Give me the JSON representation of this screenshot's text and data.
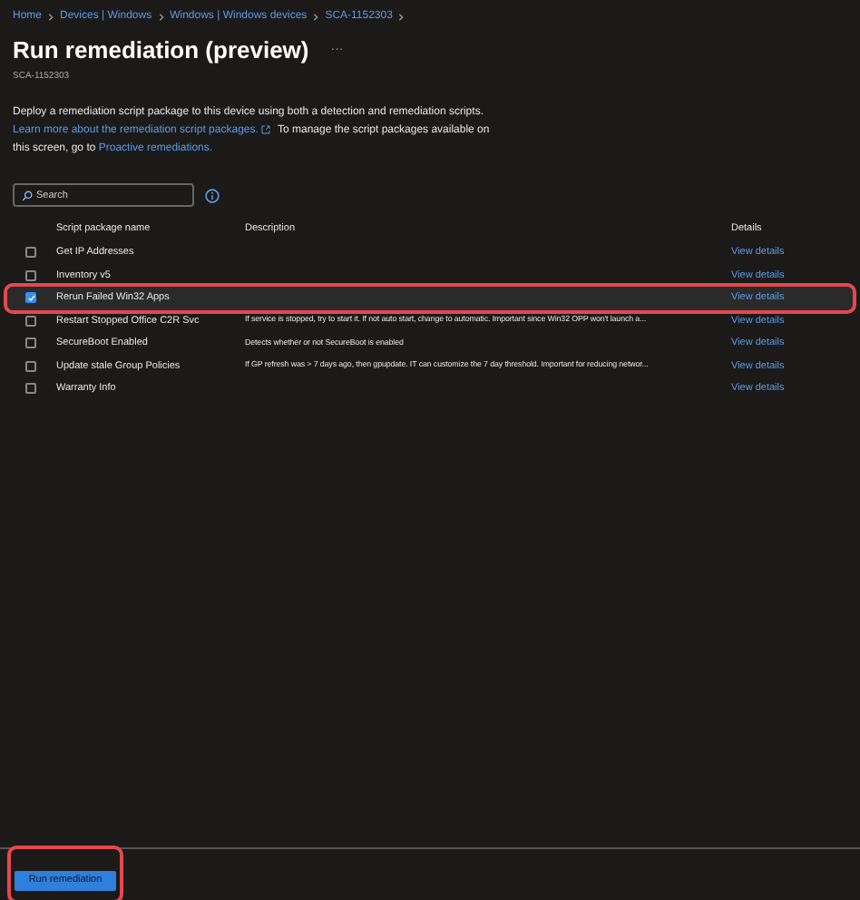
{
  "breadcrumb": [
    "Home",
    "Devices | Windows",
    "Windows | Windows devices",
    "SCA-1152303"
  ],
  "title": "Run remediation (preview)",
  "more": "···",
  "subtitle": "SCA-1152303",
  "intro": {
    "text": "Deploy a remediation script package to this device using both a detection and remediation scripts.",
    "link1": "Learn more about the remediation script packages.",
    "middle": "To manage the script packages available on this screen, go to",
    "link2": "Proactive remediations."
  },
  "search": {
    "placeholder": "Search"
  },
  "table": {
    "columns": [
      "Script package name",
      "Description",
      "Details"
    ],
    "rows": [
      {
        "name": "Get IP Addresses",
        "description": "",
        "details": "View details",
        "checked": false,
        "highlighted": false
      },
      {
        "name": "Inventory v5",
        "description": "",
        "details": "View details",
        "checked": false,
        "highlighted": false
      },
      {
        "name": "Rerun Failed Win32 Apps",
        "description": "",
        "details": "View details",
        "checked": true,
        "highlighted": true
      },
      {
        "name": "Restart Stopped Office C2R Svc",
        "description": "If service is stopped, try to start it. If not auto start, change to automatic. Important since Win32 OPP won't launch a...",
        "details": "View details",
        "checked": false,
        "highlighted": false
      },
      {
        "name": "SecureBoot Enabled",
        "description": "Detects whether or not SecureBoot is enabled",
        "details": "View details",
        "checked": false,
        "highlighted": false
      },
      {
        "name": "Update stale Group Policies",
        "description": "If GP refresh was > 7 days ago, then gpupdate. IT can customize the 7 day threshold. Important for reducing networ...",
        "details": "View details",
        "checked": false,
        "highlighted": false
      },
      {
        "name": "Warranty Info",
        "description": "",
        "details": "View details",
        "checked": false,
        "highlighted": false
      }
    ]
  },
  "run_button": {
    "label": "Run remediation",
    "highlighted": true
  }
}
